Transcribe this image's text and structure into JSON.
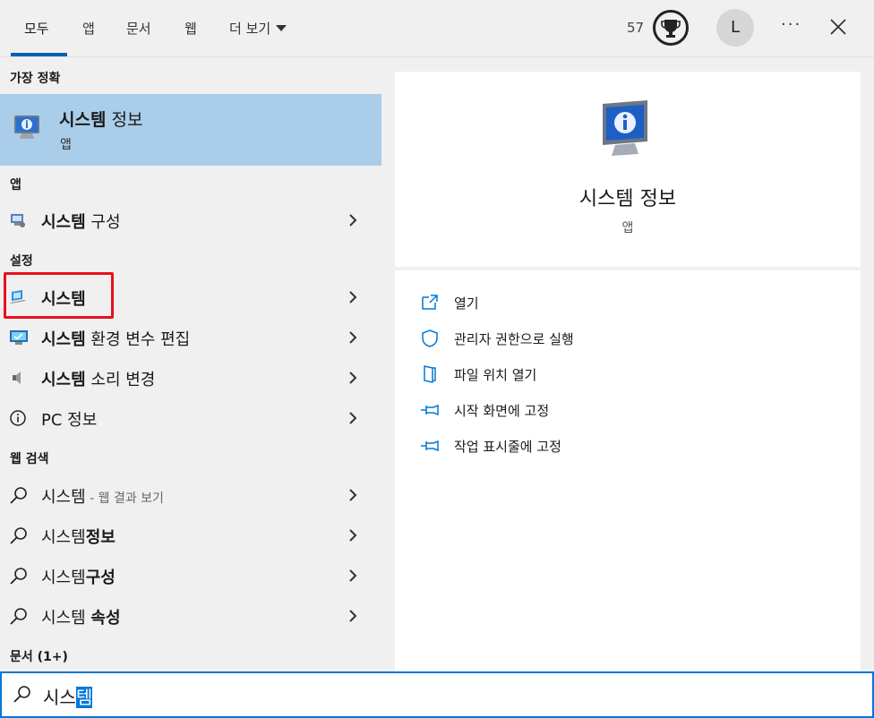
{
  "tabs": [
    {
      "label": "모두"
    },
    {
      "label": "앱"
    },
    {
      "label": "문서"
    },
    {
      "label": "웹"
    },
    {
      "label": "더 보기"
    }
  ],
  "header": {
    "points": "57",
    "avatar_letter": "L",
    "more_label": "···"
  },
  "sections": {
    "best_match": "가장 정확",
    "apps": "앱",
    "settings": "설정",
    "web": "웹 검색",
    "documents": "문서 (1+)"
  },
  "best_match": {
    "title_bold": "시스템",
    "title_rest": " 정보",
    "subtitle": "앱"
  },
  "apps": [
    {
      "bold": "시스템",
      "rest": " 구성"
    }
  ],
  "settings": [
    {
      "bold": "시스템",
      "rest": ""
    },
    {
      "bold": "시스템",
      "rest": " 환경 변수 편집"
    },
    {
      "bold": "시스템",
      "rest": " 소리 변경"
    },
    {
      "bold": "",
      "rest": "PC 정보"
    }
  ],
  "web": [
    {
      "plain": "시스템",
      "bold": "",
      "dim": " - 웹 결과 보기"
    },
    {
      "plain": "시스템",
      "bold": "정보",
      "dim": ""
    },
    {
      "plain": "시스템",
      "bold": "구성",
      "dim": ""
    },
    {
      "plain": "시스템 ",
      "bold": "속성",
      "dim": ""
    }
  ],
  "detail": {
    "title": "시스템 정보",
    "subtitle": "앱"
  },
  "actions": [
    {
      "label": "열기",
      "icon": "open-icon"
    },
    {
      "label": "관리자 권한으로 실행",
      "icon": "shield-icon"
    },
    {
      "label": "파일 위치 열기",
      "icon": "file-location-icon"
    },
    {
      "label": "시작 화면에 고정",
      "icon": "pin-icon"
    },
    {
      "label": "작업 표시줄에 고정",
      "icon": "pin-icon"
    }
  ],
  "search": {
    "typed": "시스",
    "selected": "템"
  },
  "colors": {
    "accent": "#0078d7",
    "highlight": "#aacde9",
    "annotation": "#e8101c"
  }
}
